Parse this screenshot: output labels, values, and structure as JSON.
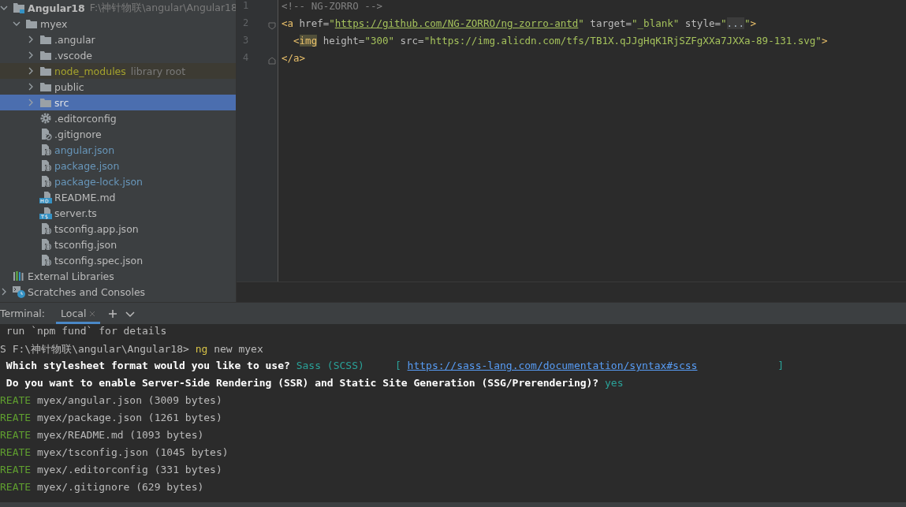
{
  "project_tree": [
    {
      "name": "Angular18",
      "hint": "F:\\神针物联\\angular\\Angular18",
      "kind": "project",
      "expanded": true,
      "selected": false,
      "children": [
        {
          "name": "myex",
          "kind": "folder",
          "expanded": true,
          "selected": false,
          "children": [
            {
              "name": ".angular",
              "kind": "folder",
              "expanded": false,
              "selected": false
            },
            {
              "name": ".vscode",
              "kind": "folder",
              "expanded": false,
              "selected": false
            },
            {
              "name": "node_modules",
              "hint": "library root",
              "kind": "folder",
              "excluded": true,
              "expanded": false,
              "selected": false
            },
            {
              "name": "public",
              "kind": "folder",
              "expanded": false,
              "selected": false
            },
            {
              "name": "src",
              "kind": "folder",
              "expanded": false,
              "selected": true
            },
            {
              "name": ".editorconfig",
              "kind": "config",
              "selected": false
            },
            {
              "name": ".gitignore",
              "kind": "ignore",
              "selected": false
            },
            {
              "name": "angular.json",
              "kind": "json",
              "modified": true,
              "selected": false
            },
            {
              "name": "package.json",
              "kind": "json",
              "modified": true,
              "selected": false
            },
            {
              "name": "package-lock.json",
              "kind": "json",
              "modified": true,
              "selected": false
            },
            {
              "name": "README.md",
              "kind": "markdown",
              "selected": false
            },
            {
              "name": "server.ts",
              "kind": "typescript",
              "selected": false
            },
            {
              "name": "tsconfig.app.json",
              "kind": "json",
              "selected": false
            },
            {
              "name": "tsconfig.json",
              "kind": "json",
              "selected": false
            },
            {
              "name": "tsconfig.spec.json",
              "kind": "json",
              "selected": false
            }
          ]
        }
      ]
    },
    {
      "name": "External Libraries",
      "kind": "libraries",
      "selected": false
    },
    {
      "name": "Scratches and Consoles",
      "kind": "scratches",
      "expanded": false,
      "selected": false
    }
  ],
  "editor": {
    "lines": [
      {
        "number": "1",
        "segments": [
          {
            "kind": "comment",
            "text": "<!-- NG-ZORRO -->"
          }
        ]
      },
      {
        "number": "2",
        "fold": true,
        "segments": [
          {
            "kind": "tag",
            "text": "<a "
          },
          {
            "kind": "attr",
            "text": "href="
          },
          {
            "kind": "string",
            "text": "\""
          },
          {
            "kind": "link",
            "text": "https://github.com/NG-ZORRO/ng-zorro-antd"
          },
          {
            "kind": "string",
            "text": "\""
          },
          {
            "kind": "attr",
            "text": " target="
          },
          {
            "kind": "string",
            "text": "\"_blank\""
          },
          {
            "kind": "attr",
            "text": " style="
          },
          {
            "kind": "string",
            "text": "\""
          },
          {
            "kind": "folded",
            "text": "..."
          },
          {
            "kind": "string",
            "text": "\""
          },
          {
            "kind": "tag",
            "text": ">"
          }
        ]
      },
      {
        "number": "3",
        "segments": [
          {
            "kind": "tag",
            "text": "  <"
          },
          {
            "kind": "tag_match",
            "text": "img"
          },
          {
            "kind": "attr",
            "text": " height="
          },
          {
            "kind": "string",
            "text": "\"300\""
          },
          {
            "kind": "attr",
            "text": " src="
          },
          {
            "kind": "string",
            "text": "\"https://img.alicdn.com/tfs/TB1X.qJJgHqK1RjSZFgXXa7JXXa-89-131.svg\""
          },
          {
            "kind": "tag",
            "text": ">"
          }
        ]
      },
      {
        "number": "4",
        "fold": true,
        "segments": [
          {
            "kind": "tag",
            "text": "</a>"
          }
        ]
      }
    ]
  },
  "terminal": {
    "label": "Terminal:",
    "tabs": [
      {
        "label": "Local",
        "selected": true
      }
    ],
    "lines": [
      [
        {
          "kind": "plain",
          "text": " run `npm fund` for details"
        }
      ],
      [
        {
          "kind": "plain",
          "text": "S F:\\神针物联\\angular\\Angular18> "
        },
        {
          "kind": "command",
          "text": "ng"
        },
        {
          "kind": "plain",
          "text": " new myex"
        }
      ],
      [
        {
          "kind": "bold",
          "text": " Which stylesheet format would you like to use? "
        },
        {
          "kind": "answer",
          "text": "Sass (SCSS)"
        },
        {
          "kind": "answer",
          "text": "     [ "
        },
        {
          "kind": "link",
          "text": "https://sass-lang.com/documentation/syntax#scss"
        },
        {
          "kind": "answer",
          "text": "             ]"
        }
      ],
      [
        {
          "kind": "bold",
          "text": " Do you want to enable Server-Side Rendering (SSR) and Static Site Generation (SSG/Prerendering)? "
        },
        {
          "kind": "answer",
          "text": "yes"
        }
      ],
      [
        {
          "kind": "created",
          "text": "REATE"
        },
        {
          "kind": "plain",
          "text": " myex/angular.json (3009 bytes)"
        }
      ],
      [
        {
          "kind": "created",
          "text": "REATE"
        },
        {
          "kind": "plain",
          "text": " myex/package.json (1261 bytes)"
        }
      ],
      [
        {
          "kind": "created",
          "text": "REATE"
        },
        {
          "kind": "plain",
          "text": " myex/README.md (1093 bytes)"
        }
      ],
      [
        {
          "kind": "created",
          "text": "REATE"
        },
        {
          "kind": "plain",
          "text": " myex/tsconfig.json (1045 bytes)"
        }
      ],
      [
        {
          "kind": "created",
          "text": "REATE"
        },
        {
          "kind": "plain",
          "text": " myex/.editorconfig (331 bytes)"
        }
      ],
      [
        {
          "kind": "created",
          "text": "REATE"
        },
        {
          "kind": "plain",
          "text": " myex/.gitignore (629 bytes)"
        }
      ]
    ]
  }
}
